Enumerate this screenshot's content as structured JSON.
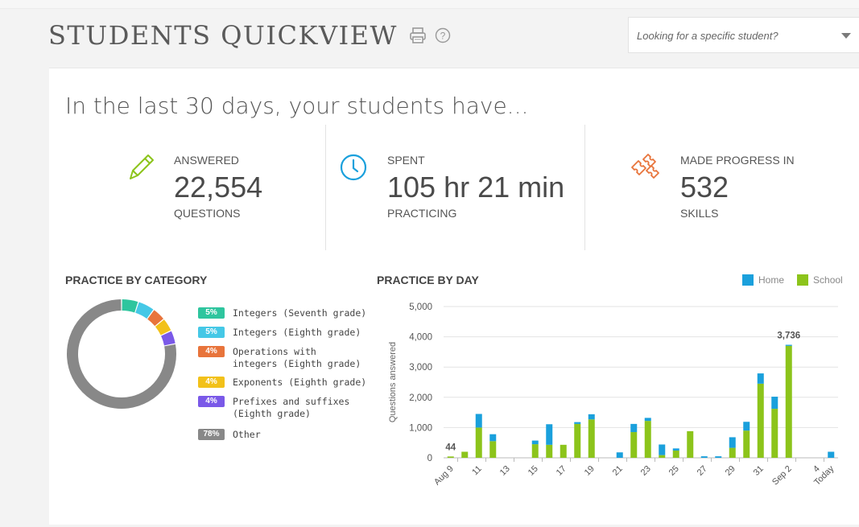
{
  "header": {
    "title": "STUDENTS QUICKVIEW",
    "search_placeholder": "Looking for a specific student?"
  },
  "summary": {
    "intro": "In the last 30 days, your students have...",
    "answered": {
      "label": "ANSWERED",
      "value": "22,554",
      "sub": "QUESTIONS"
    },
    "spent": {
      "label": "SPENT",
      "value": "105 hr 21 min",
      "sub": "PRACTICING"
    },
    "progress": {
      "label": "MADE PROGRESS IN",
      "value": "532",
      "sub": "SKILLS"
    }
  },
  "colors": {
    "home": "#1aa0dc",
    "school": "#8cc41b",
    "answered_icon": "#8cc41b",
    "spent_icon": "#1aa0dc",
    "progress_icon": "#e8743b"
  },
  "practice_by_category": {
    "title": "PRACTICE BY CATEGORY",
    "items": [
      {
        "pct": "5%",
        "label": "Integers (Seventh grade)",
        "color": "#2ec59e",
        "share": 5
      },
      {
        "pct": "5%",
        "label": "Integers (Eighth grade)",
        "color": "#45c8e6",
        "share": 5
      },
      {
        "pct": "4%",
        "label": "Operations with integers (Eighth grade)",
        "color": "#e8743b",
        "share": 4
      },
      {
        "pct": "4%",
        "label": "Exponents (Eighth grade)",
        "color": "#f2c11a",
        "share": 4
      },
      {
        "pct": "4%",
        "label": "Prefixes and suffixes (Eighth grade)",
        "color": "#7a59e8",
        "share": 4
      },
      {
        "pct": "78%",
        "label": "Other",
        "color": "#888888",
        "share": 78
      }
    ]
  },
  "practice_by_day": {
    "title": "PRACTICE BY DAY",
    "legend_home": "Home",
    "legend_school": "School"
  },
  "chart_data": {
    "type": "bar",
    "stacked": true,
    "ylabel": "Questions answered",
    "ylim": [
      0,
      5000
    ],
    "yticks": [
      "0",
      "1,000",
      "2,000",
      "3,000",
      "4,000",
      "5,000"
    ],
    "ytick_values": [
      0,
      1000,
      2000,
      3000,
      4000,
      5000
    ],
    "categories": [
      "Aug 9",
      "10",
      "11",
      "12",
      "13",
      "14",
      "15",
      "16",
      "17",
      "18",
      "19",
      "20",
      "21",
      "22",
      "23",
      "24",
      "25",
      "26",
      "27",
      "28",
      "29",
      "30",
      "31",
      "Sep 1",
      "Sep 2",
      "3",
      "4",
      "Today"
    ],
    "xtick_labels": [
      "Aug 9",
      "",
      "11",
      "",
      "13",
      "",
      "15",
      "",
      "17",
      "",
      "19",
      "",
      "21",
      "",
      "23",
      "",
      "25",
      "",
      "27",
      "",
      "29",
      "",
      "31",
      "",
      "Sep 2",
      "",
      "4",
      "Today"
    ],
    "series": [
      {
        "name": "School",
        "values": [
          44,
          200,
          1000,
          550,
          0,
          0,
          450,
          430,
          430,
          1120,
          1270,
          0,
          0,
          850,
          1220,
          90,
          240,
          880,
          0,
          0,
          330,
          900,
          2450,
          1620,
          3700,
          0,
          0,
          0
        ]
      },
      {
        "name": "Home",
        "values": [
          0,
          0,
          450,
          230,
          0,
          0,
          120,
          680,
          0,
          60,
          170,
          0,
          180,
          270,
          100,
          350,
          70,
          0,
          50,
          50,
          350,
          290,
          340,
          400,
          36,
          0,
          0,
          200
        ]
      }
    ],
    "annotations": [
      {
        "category": "Aug 9",
        "text": "44"
      },
      {
        "category": "Sep 2",
        "text": "3,736"
      }
    ]
  }
}
